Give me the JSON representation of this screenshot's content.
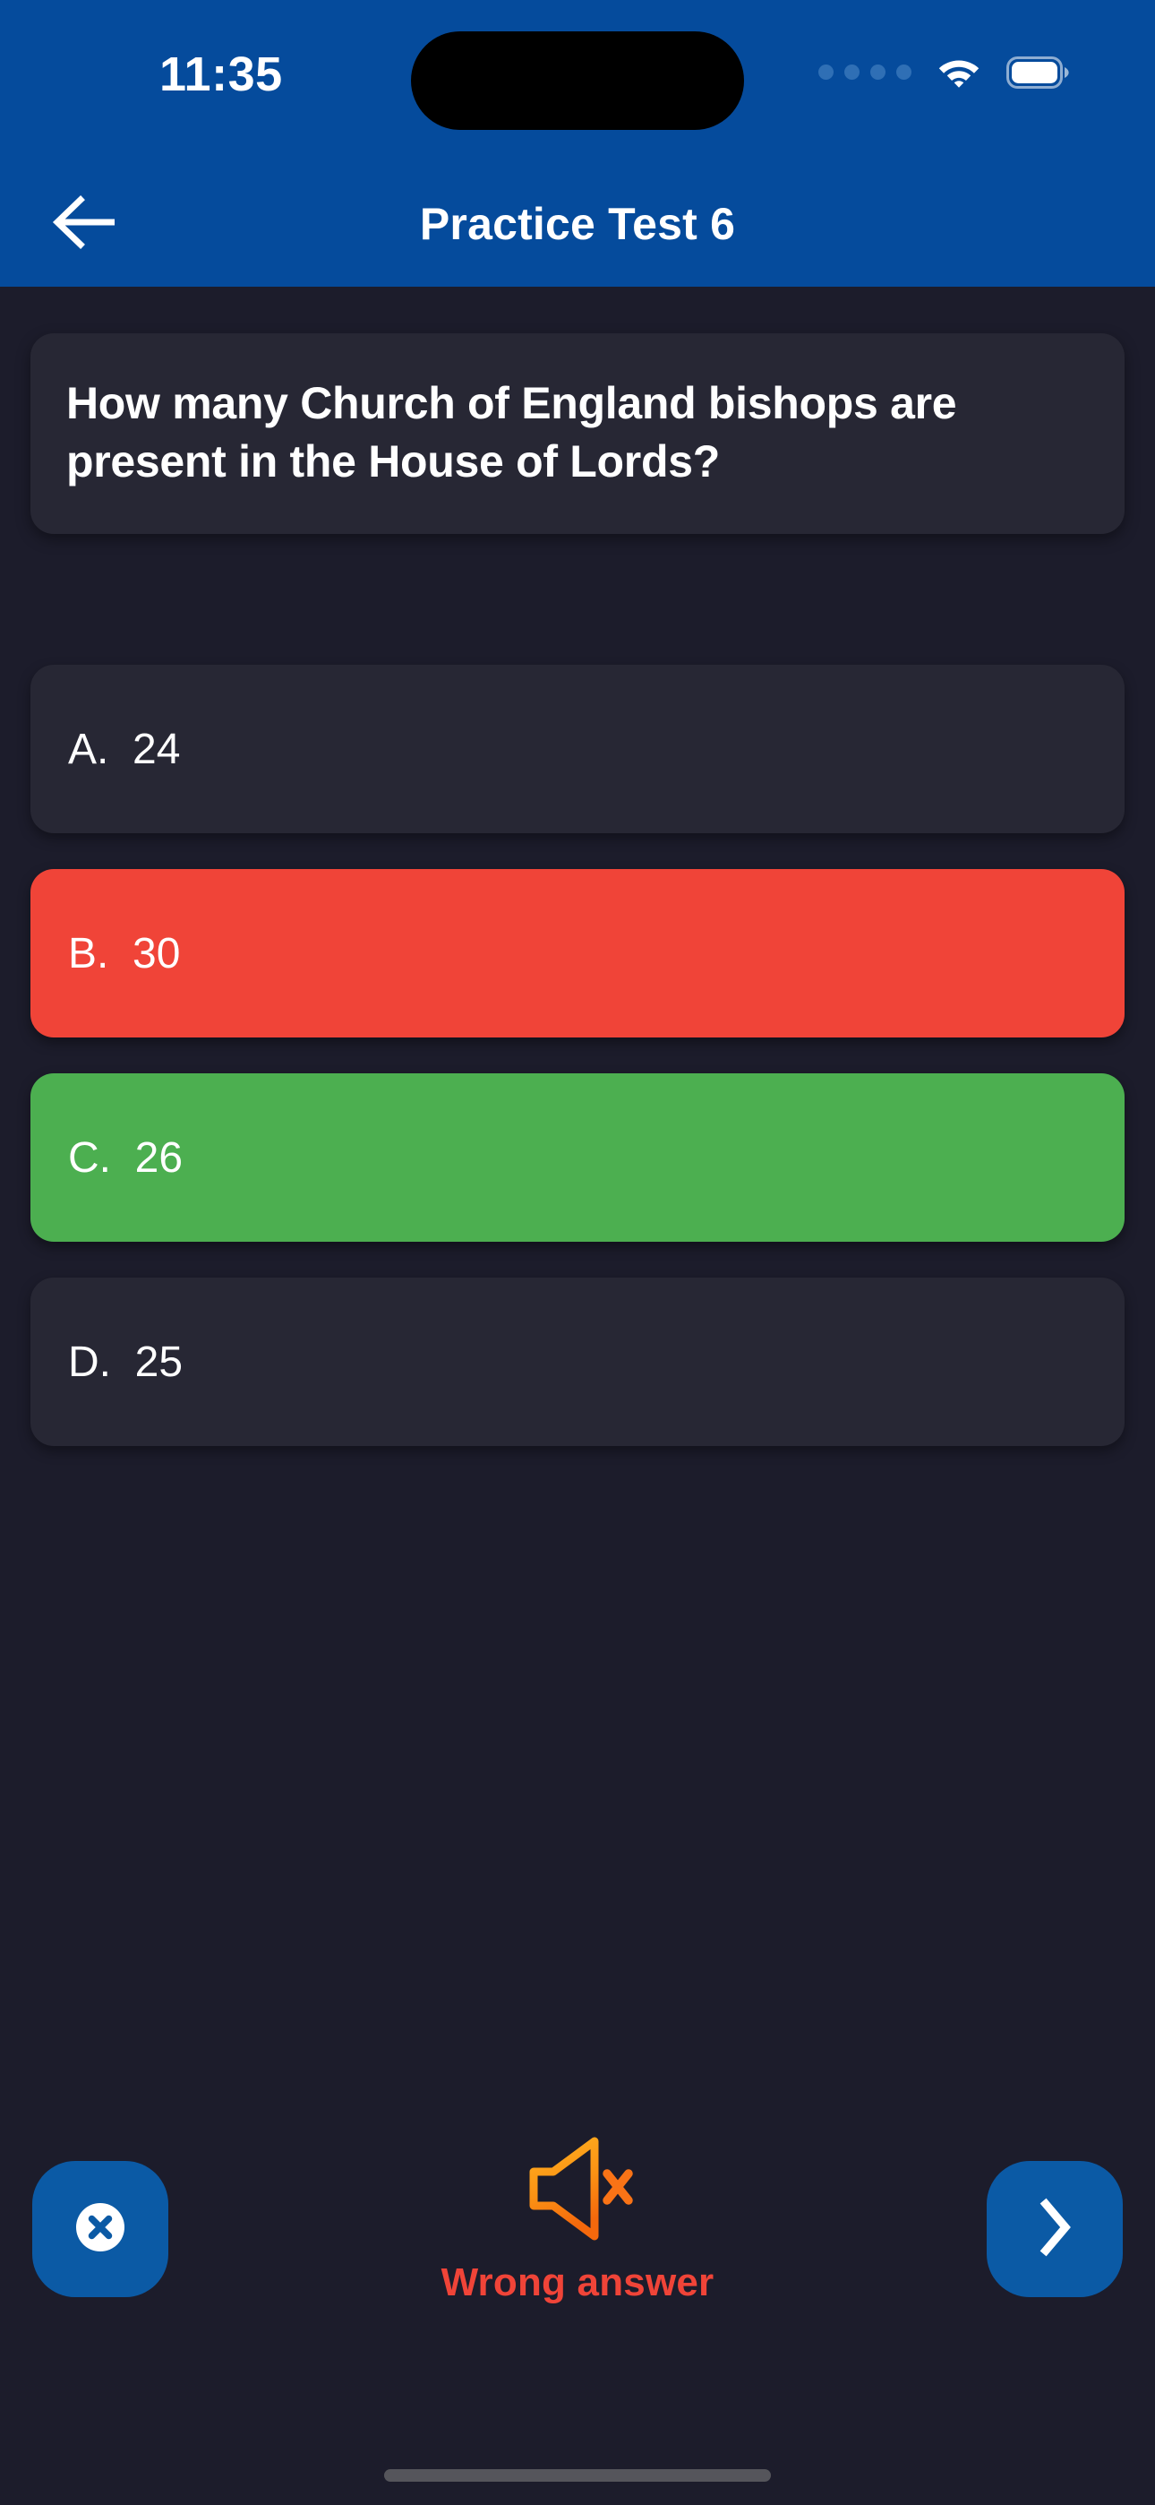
{
  "status_bar": {
    "time": "11:35",
    "signal_icon": "signal-dots-icon",
    "wifi_icon": "wifi-icon",
    "battery_icon": "battery-full-icon"
  },
  "header": {
    "back_icon": "arrow-left-icon",
    "title": "Practice Test 6"
  },
  "question": {
    "text": "How many Church of England bishops are present in the House of Lords?"
  },
  "options": [
    {
      "id": "a",
      "prefix": "A.",
      "text": "24",
      "state": "default"
    },
    {
      "id": "b",
      "prefix": "B.",
      "text": "30",
      "state": "wrong"
    },
    {
      "id": "c",
      "prefix": "C.",
      "text": "26",
      "state": "correct"
    },
    {
      "id": "d",
      "prefix": "D.",
      "text": "25",
      "state": "default"
    }
  ],
  "bottom_bar": {
    "close_icon": "close-circle-icon",
    "mute_icon": "speaker-mute-icon",
    "feedback_text": "Wrong answer",
    "next_icon": "chevron-right-icon"
  },
  "colors": {
    "header_blue": "#054b9c",
    "button_blue": "#0b5aa5",
    "page_background": "#1c1c2b",
    "card_background": "#272734",
    "wrong_red": "#f04438",
    "correct_green": "#4caf50",
    "mute_orange": "#f97316",
    "text_white": "#ffffff"
  }
}
